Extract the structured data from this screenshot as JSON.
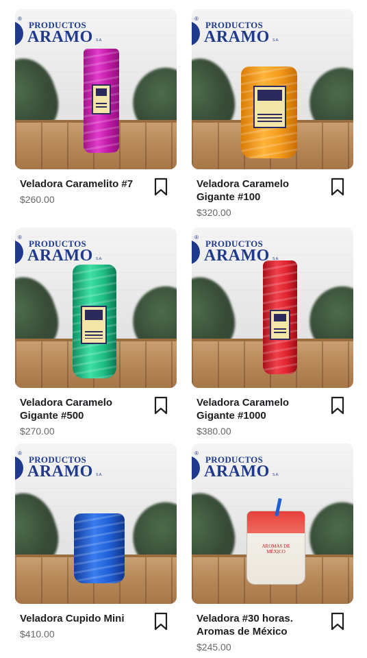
{
  "brand": {
    "registered": "®",
    "line1": "PRODUCTOS",
    "line2": "ARAMO",
    "suffix": "S.A."
  },
  "colors": {
    "brand_blue": "#1f3a8c",
    "price_gray": "#65676b",
    "title_black": "#1c1e21"
  },
  "products": [
    {
      "title": "Veladora Caramelito #7",
      "price": "$260.00",
      "candle_color": "#d21fb6",
      "save_icon": "bookmark-icon"
    },
    {
      "title": "Veladora Caramelo Gigante #100",
      "price": "$320.00",
      "candle_color": "#f39a1a",
      "save_icon": "bookmark-icon"
    },
    {
      "title": "Veladora Caramelo Gigante #500",
      "price": "$270.00",
      "candle_color": "#1fbf86",
      "save_icon": "bookmark-icon"
    },
    {
      "title": "Veladora Caramelo Gigante #1000",
      "price": "$380.00",
      "candle_color": "#e0242f",
      "save_icon": "bookmark-icon"
    },
    {
      "title": "Veladora Cupido Mini",
      "price": "$410.00",
      "candle_color": "#1f5fd6",
      "save_icon": "bookmark-icon"
    },
    {
      "title": "Veladora #30 horas. Aromas de México",
      "price": "$245.00",
      "candle_color": "#e5413b",
      "save_icon": "bookmark-icon",
      "label_text": "AROMAS DE MÉXICO"
    }
  ]
}
